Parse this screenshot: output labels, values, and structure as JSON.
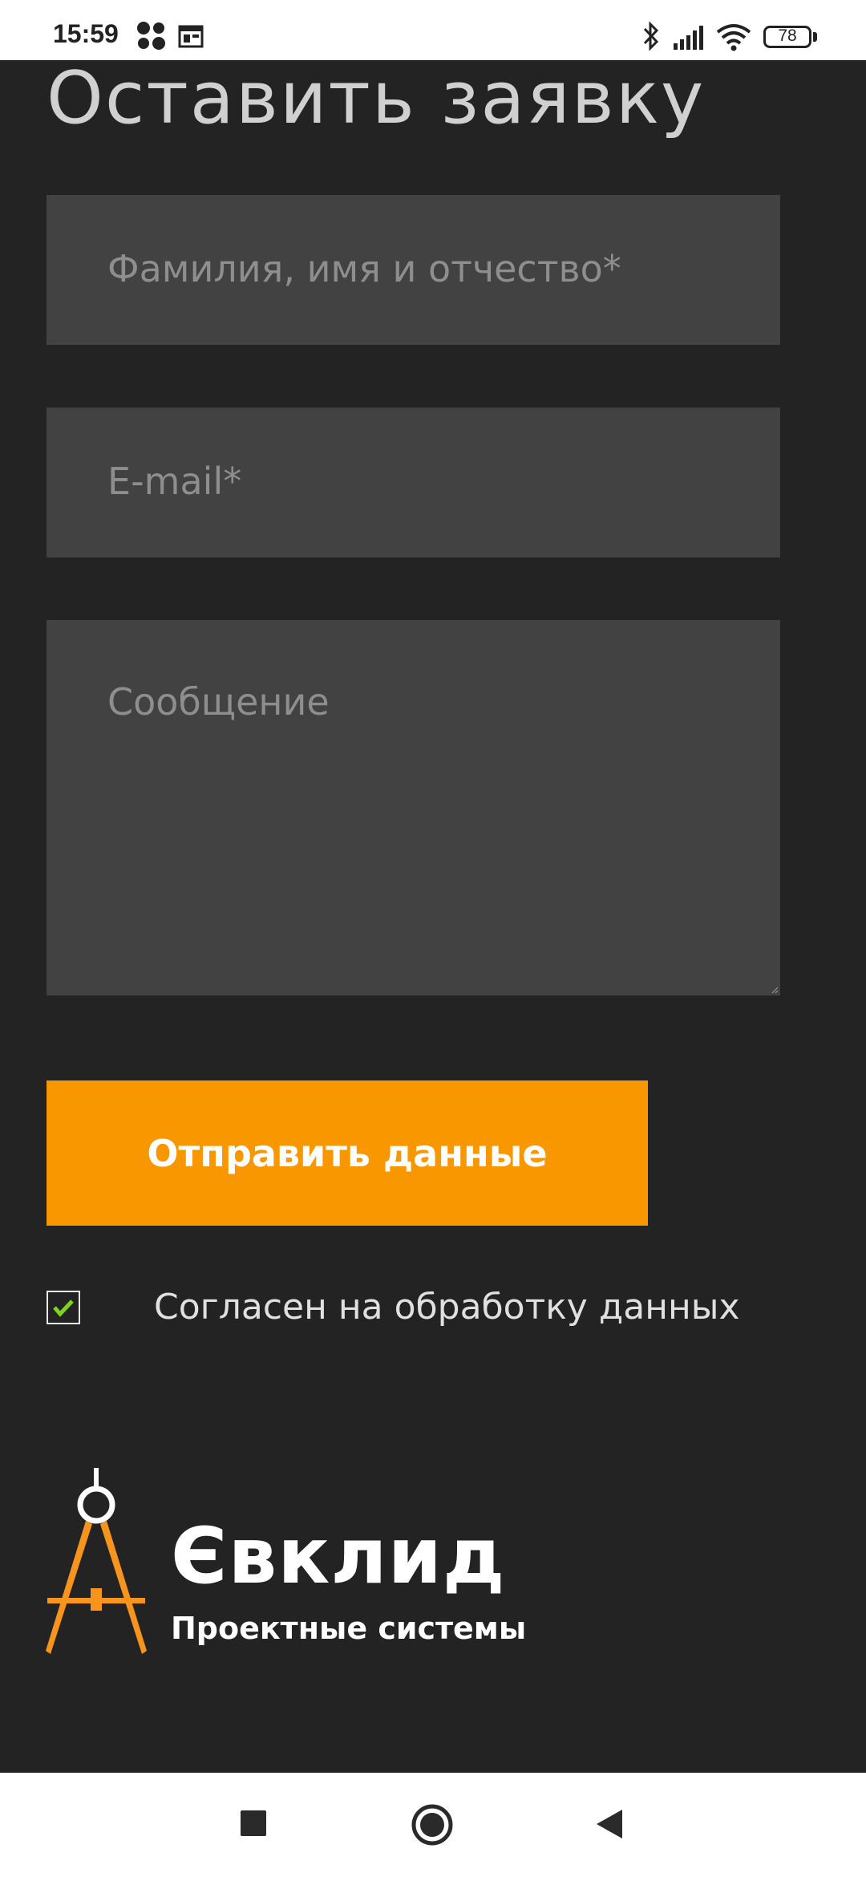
{
  "status_bar": {
    "time": "15:59",
    "battery": "78",
    "icons": [
      "dots-app-icon",
      "calendar-icon",
      "bluetooth-icon",
      "signal-icon",
      "wifi-icon",
      "battery-icon"
    ]
  },
  "form": {
    "title": "Оставить заявку",
    "name_placeholder": "Фамилия, имя и отчество*",
    "email_placeholder": "E-mail*",
    "message_placeholder": "Сообщение",
    "submit_label": "Отправить данные",
    "consent_label": "Согласен на обработку данных",
    "consent_checked": true
  },
  "logo": {
    "name": "Євклид",
    "subtitle": "Проектные системы"
  },
  "nav_bar": {
    "buttons": [
      "recents-button",
      "home-button",
      "back-button"
    ]
  },
  "colors": {
    "background": "#232323",
    "field": "#424242",
    "accent": "#f99700",
    "check": "#7ed321"
  }
}
